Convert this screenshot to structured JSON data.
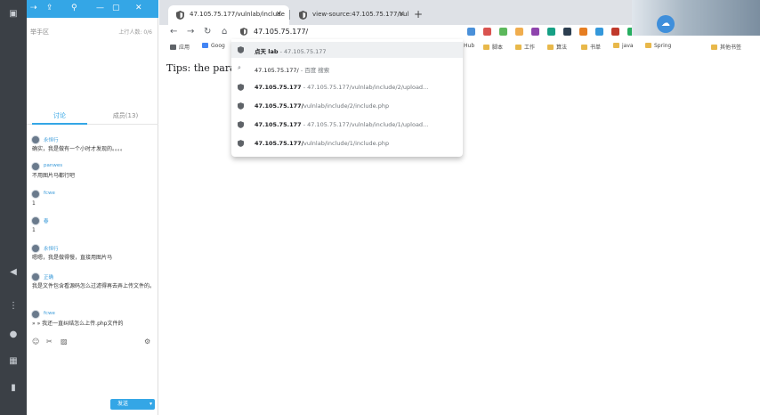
{
  "chat": {
    "room_name": "举手区",
    "online_count": "上行人数: 0/6",
    "tabs": {
      "discuss": "讨论",
      "members": "成员(13)"
    },
    "messages": [
      {
        "user": "永恒行",
        "text": "确实，我是做有一个小时才发现的。。。。"
      },
      {
        "user": "panwes",
        "text": "不用图片马都行吧"
      },
      {
        "user": "fcwe",
        "text": "1"
      },
      {
        "user": "春",
        "text": "1"
      },
      {
        "user": "永恒行",
        "text": "嗯嗯，我是做得慢，直接用图片马"
      },
      {
        "user": "正确",
        "text": "我是文件包含看源码怎么过滤得再去弄上传文件的。"
      },
      {
        "user": "fcwe",
        "text": "» » 我还一直纠结怎么上传.php文件的"
      }
    ],
    "send_label": "发送"
  },
  "browser": {
    "tabs": [
      {
        "title": "47.105.75.177/vulnlab/include"
      },
      {
        "title": "view-source:47.105.75.177/vul"
      }
    ],
    "address": "47.105.75.177/",
    "bookmarks": [
      "应用",
      "Goog",
      "Hub",
      "脚本",
      "工作",
      "算法",
      "书单",
      "java",
      "Spring",
      "其他书签"
    ],
    "page_text": "Tips: the para",
    "suggestions": [
      {
        "bold": "点天 lab",
        "rest": " - 47.105.75.177"
      },
      {
        "bold": "47.105.75.177/",
        "rest": " - 百度 搜索"
      },
      {
        "bold": "47.105.75.177",
        "rest": " - 47.105.75.177/vulnlab/include/2/upload..."
      },
      {
        "bold": "47.105.75.177/",
        "rest": "vulnlab/include/2/include.php"
      },
      {
        "bold": "47.105.75.177",
        "rest": " - 47.105.75.177/vulnlab/include/1/upload..."
      },
      {
        "bold": "47.105.75.177/",
        "rest": "vulnlab/include/1/include.php"
      }
    ]
  },
  "colors": {
    "accent": "#34a6e6",
    "rail": "#3b4046",
    "tabstrip": "#dee1e6"
  }
}
